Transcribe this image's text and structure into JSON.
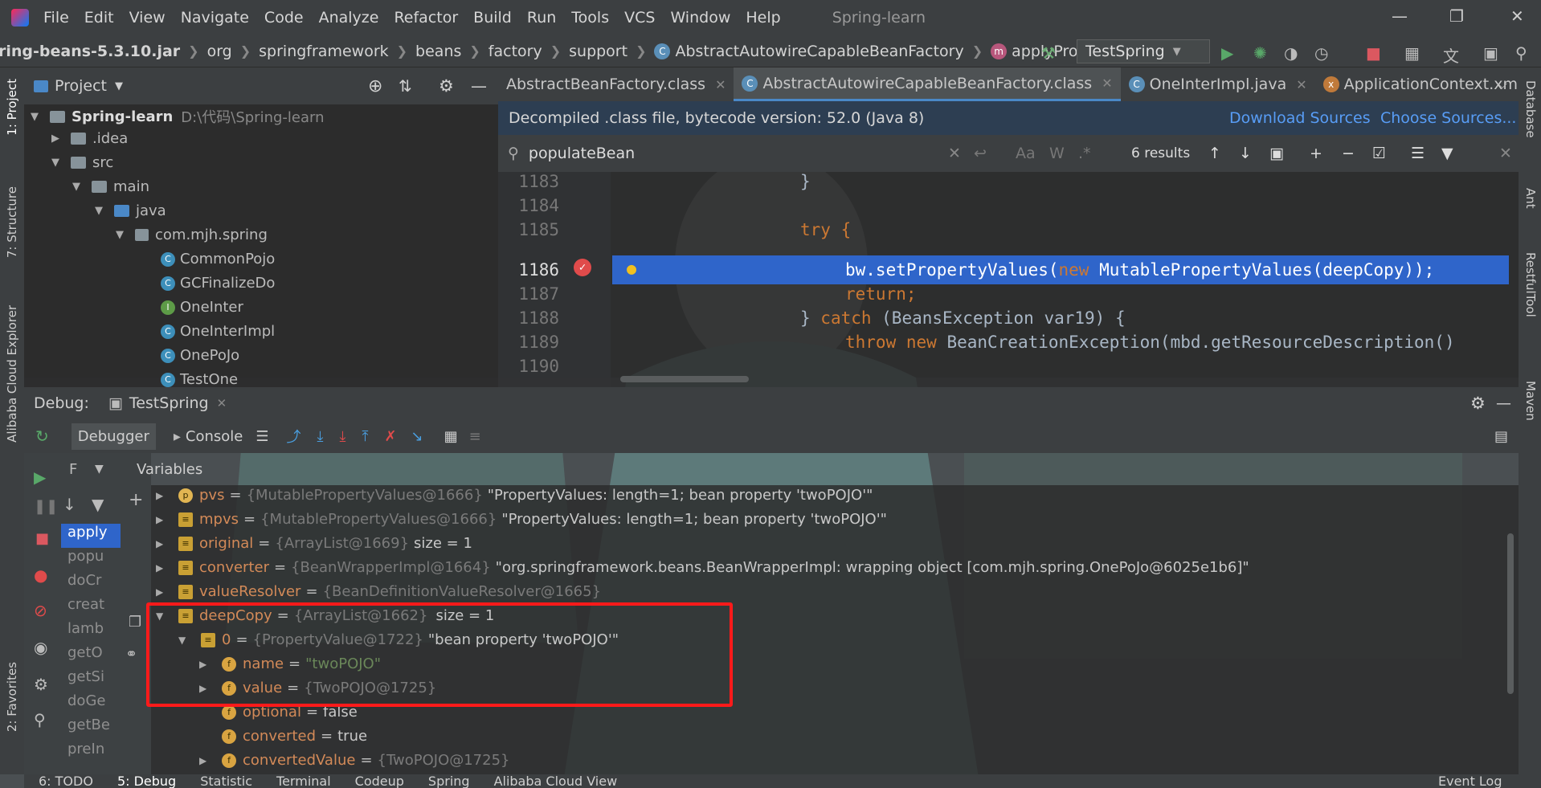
{
  "menu": {
    "items": [
      "File",
      "Edit",
      "View",
      "Navigate",
      "Code",
      "Analyze",
      "Refactor",
      "Build",
      "Run",
      "Tools",
      "VCS",
      "Window",
      "Help"
    ],
    "title": "Spring-learn"
  },
  "breadcrumb": [
    "ring-beans-5.3.10.jar",
    "org",
    "springframework",
    "beans",
    "factory",
    "support",
    "AbstractAutowireCapableBeanFactory",
    "applyPropertyValues"
  ],
  "run_config": "TestSpring",
  "project": {
    "label": "Project",
    "root": "Spring-learn",
    "root_path": "D:\\代码\\Spring-learn",
    "items": [
      ".idea",
      "src",
      "main",
      "java",
      "com.mjh.spring",
      "CommonPojo",
      "GCFinalizeDo",
      "OneInter",
      "OneInterImpl",
      "OnePoJo",
      "TestOne"
    ]
  },
  "tabs": [
    "AbstractBeanFactory.class",
    "AbstractAutowireCapableBeanFactory.class",
    "OneInterImpl.java",
    "ApplicationContext.xml"
  ],
  "banner": {
    "text": "Decompiled .class file, bytecode version: 52.0 (Java 8)",
    "download": "Download Sources",
    "choose": "Choose Sources..."
  },
  "find": {
    "query": "populateBean",
    "results": "6 results",
    "case": "Aa",
    "words": "W",
    "regex": ".*"
  },
  "code": {
    "lines": [
      "1183",
      "1184",
      "1185",
      "1186",
      "1187",
      "1188",
      "1189",
      "1190"
    ],
    "l1183": "}",
    "l1185": "try {",
    "l1186a": "bw.setPropertyValues(",
    "l1186b": "new",
    "l1186c": " MutablePropertyValues(deepCopy));",
    "l1187": "return;",
    "l1188a": "} ",
    "l1188b": "catch",
    "l1188c": " (BeansException var19) {",
    "l1189a": "throw new",
    "l1189b": " BeanCreationException(mbd.getResourceDescription()"
  },
  "debug": {
    "label": "Debug:",
    "session": "TestSpring",
    "debugger": "Debugger",
    "console": "Console",
    "variables": "Variables",
    "frames_filter": "F"
  },
  "frames": [
    "apply",
    "popu",
    "doCr",
    "creat",
    "lamb",
    "getO",
    "getSi",
    "doGe",
    "getBe",
    "preIn"
  ],
  "vars": [
    {
      "name": "pvs",
      "type": "{MutablePropertyValues@1666}",
      "value": "\"PropertyValues: length=1; bean property 'twoPOJO'\""
    },
    {
      "name": "mpvs",
      "type": "{MutablePropertyValues@1666}",
      "value": "\"PropertyValues: length=1; bean property 'twoPOJO'\""
    },
    {
      "name": "original",
      "type": "{ArrayList@1669}",
      "value": "size = 1"
    },
    {
      "name": "converter",
      "type": "{BeanWrapperImpl@1664}",
      "value": "\"org.springframework.beans.BeanWrapperImpl: wrapping object [com.mjh.spring.OnePoJo@6025e1b6]\""
    },
    {
      "name": "valueResolver",
      "type": "{BeanDefinitionValueResolver@1665}",
      "value": ""
    },
    {
      "name": "deepCopy",
      "type": "{ArrayList@1662}",
      "value": "size = 1"
    },
    {
      "name": "0",
      "type": "{PropertyValue@1722}",
      "value": "\"bean property 'twoPOJO'\""
    },
    {
      "name": "name",
      "type": "",
      "value": "\"twoPOJO\""
    },
    {
      "name": "value",
      "type": "{TwoPOJO@1725}",
      "value": ""
    },
    {
      "name": "optional",
      "type": "",
      "value": "false"
    },
    {
      "name": "converted",
      "type": "",
      "value": "true"
    },
    {
      "name": "convertedValue",
      "type": "{TwoPOJO@1725}",
      "value": ""
    }
  ],
  "left_tools": [
    "1: Project",
    "7: Structure",
    "Alibaba Cloud Explorer",
    "2: Favorites"
  ],
  "right_tools": [
    "Database",
    "Ant",
    "RestfulTool",
    "Maven"
  ],
  "status": [
    "6: TODO",
    "5: Debug",
    "Statistic",
    "Terminal",
    "Codeup",
    "Spring",
    "Alibaba Cloud View",
    "Event Log"
  ],
  "colors": {
    "selection": "#2f65ca",
    "keyword": "#cc7832",
    "highlight_box": "#ff1a1a",
    "link": "#589df6"
  }
}
